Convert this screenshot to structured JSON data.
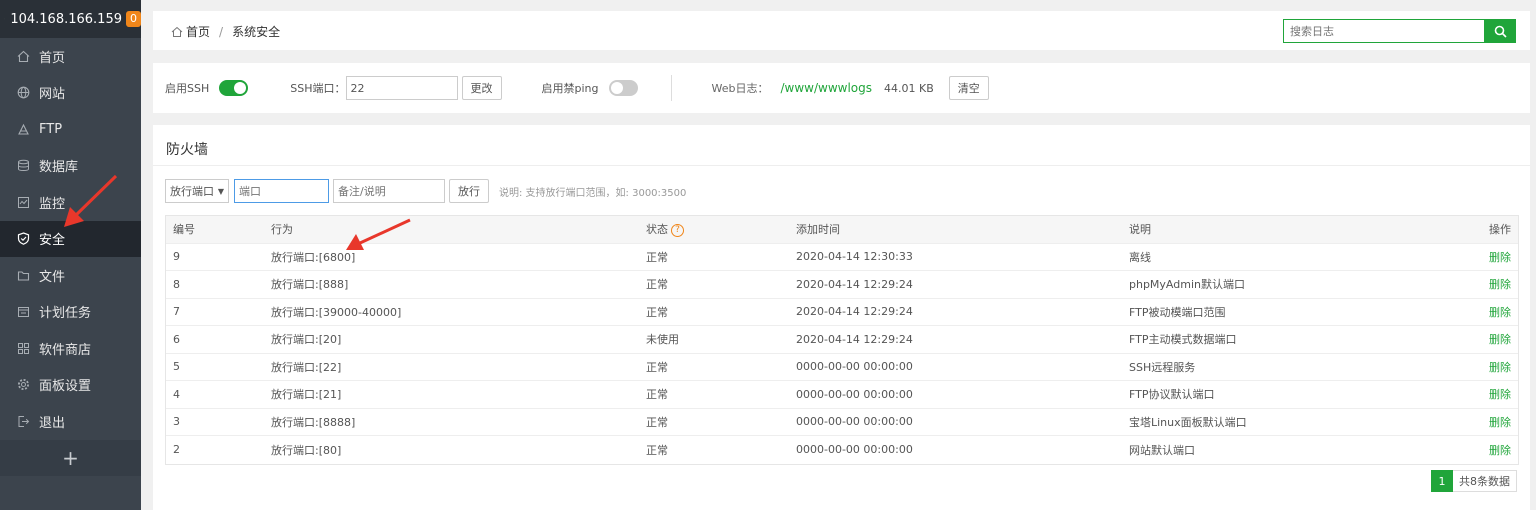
{
  "sidebar": {
    "server": "104.168.166.159",
    "badge": "0",
    "items": [
      {
        "label": "首页",
        "icon": "home-icon"
      },
      {
        "label": "网站",
        "icon": "globe-icon"
      },
      {
        "label": "FTP",
        "icon": "ftp-icon"
      },
      {
        "label": "数据库",
        "icon": "database-icon"
      },
      {
        "label": "监控",
        "icon": "monitor-icon"
      },
      {
        "label": "安全",
        "icon": "shield-icon",
        "active": true
      },
      {
        "label": "文件",
        "icon": "folder-icon"
      },
      {
        "label": "计划任务",
        "icon": "calendar-icon"
      },
      {
        "label": "软件商店",
        "icon": "grid-icon"
      },
      {
        "label": "面板设置",
        "icon": "gear-icon"
      },
      {
        "label": "退出",
        "icon": "logout-icon"
      }
    ],
    "add": "+"
  },
  "breadcrumb": {
    "home": "首页",
    "sep": "/",
    "current": "系统安全"
  },
  "search": {
    "placeholder": "搜索日志"
  },
  "settings": {
    "ssh_label": "启用SSH",
    "ssh_on": true,
    "port_label": "SSH端口：",
    "port_value": "22",
    "change_btn": "更改",
    "ping_label": "启用禁ping",
    "ping_on": false,
    "weblog_label": "Web日志：",
    "weblog_path": "/www/wwwlogs",
    "weblog_size": "44.01 KB",
    "clear_btn": "清空"
  },
  "firewall": {
    "title": "防火墙",
    "select": "放行端口",
    "port_placeholder": "端口",
    "note_placeholder": "备注/说明",
    "release_btn": "放行",
    "hint": "说明: 支持放行端口范围，如: 3000:3500",
    "columns": [
      "编号",
      "行为",
      "状态",
      "添加时间",
      "说明",
      "操作"
    ],
    "rows": [
      {
        "id": "9",
        "action": "放行端口:[6800]",
        "status": "正常",
        "time": "2020-04-14 12:30:33",
        "desc": "离线",
        "op": "删除"
      },
      {
        "id": "8",
        "action": "放行端口:[888]",
        "status": "正常",
        "time": "2020-04-14 12:29:24",
        "desc": "phpMyAdmin默认端口",
        "op": "删除"
      },
      {
        "id": "7",
        "action": "放行端口:[39000-40000]",
        "status": "正常",
        "time": "2020-04-14 12:29:24",
        "desc": "FTP被动模端口范围",
        "op": "删除"
      },
      {
        "id": "6",
        "action": "放行端口:[20]",
        "status": "未使用",
        "time": "2020-04-14 12:29:24",
        "desc": "FTP主动模式数据端口",
        "op": "删除"
      },
      {
        "id": "5",
        "action": "放行端口:[22]",
        "status": "正常",
        "time": "0000-00-00 00:00:00",
        "desc": "SSH远程服务",
        "op": "删除"
      },
      {
        "id": "4",
        "action": "放行端口:[21]",
        "status": "正常",
        "time": "0000-00-00 00:00:00",
        "desc": "FTP协议默认端口",
        "op": "删除"
      },
      {
        "id": "3",
        "action": "放行端口:[8888]",
        "status": "正常",
        "time": "0000-00-00 00:00:00",
        "desc": "宝塔Linux面板默认端口",
        "op": "删除"
      },
      {
        "id": "2",
        "action": "放行端口:[80]",
        "status": "正常",
        "time": "0000-00-00 00:00:00",
        "desc": "网站默认端口",
        "op": "删除"
      }
    ],
    "page": "1",
    "total": "共8条数据"
  },
  "colors": {
    "accent": "#20a53a",
    "badge": "#f0861a",
    "sidebar": "#3c444d",
    "arrow": "#e8372b"
  }
}
